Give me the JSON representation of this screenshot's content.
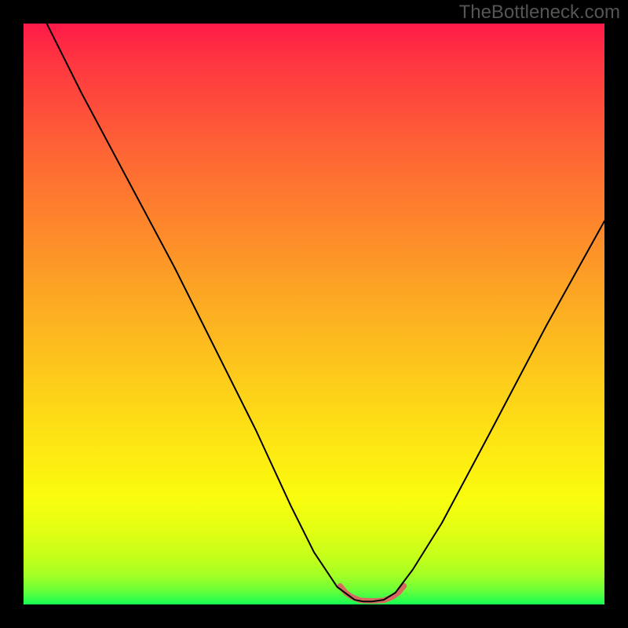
{
  "watermark": "TheBottleneck.com",
  "chart_data": {
    "type": "line",
    "title": "",
    "xlabel": "",
    "ylabel": "",
    "xlim": [
      0,
      100
    ],
    "ylim": [
      0,
      100
    ],
    "series": [
      {
        "name": "main-curve",
        "color": "#000000",
        "stroke_width": 2,
        "x": [
          4,
          10,
          18,
          26,
          34,
          40,
          46,
          50,
          54,
          57,
          58.5,
          60,
          62,
          64,
          67,
          72,
          80,
          90,
          100
        ],
        "y": [
          100,
          88,
          73,
          58,
          42,
          30,
          17,
          9,
          3,
          0.8,
          0.5,
          0.5,
          0.8,
          2,
          6,
          14,
          29,
          48,
          66
        ]
      },
      {
        "name": "bottom-segment",
        "color": "#D86A60",
        "stroke_width": 7,
        "x": [
          54.5,
          55.5,
          56.5,
          58,
          60,
          62,
          63.5,
          64.5,
          65.5
        ],
        "y": [
          3.2,
          2.0,
          1.3,
          0.7,
          0.6,
          0.7,
          1.3,
          2.0,
          3.2
        ]
      }
    ],
    "gradient_stops": [
      {
        "pos": 0.0,
        "color": "#FE1A49"
      },
      {
        "pos": 0.06,
        "color": "#FE3441"
      },
      {
        "pos": 0.24,
        "color": "#FE6A33"
      },
      {
        "pos": 0.45,
        "color": "#FDA225"
      },
      {
        "pos": 0.62,
        "color": "#FDCE1A"
      },
      {
        "pos": 0.76,
        "color": "#FDEF11"
      },
      {
        "pos": 0.82,
        "color": "#F9FD0E"
      },
      {
        "pos": 0.88,
        "color": "#DEFE14"
      },
      {
        "pos": 0.92,
        "color": "#C3FF1B"
      },
      {
        "pos": 0.95,
        "color": "#A4FF25"
      },
      {
        "pos": 0.975,
        "color": "#6CFF38"
      },
      {
        "pos": 1.0,
        "color": "#17FF56"
      }
    ]
  }
}
